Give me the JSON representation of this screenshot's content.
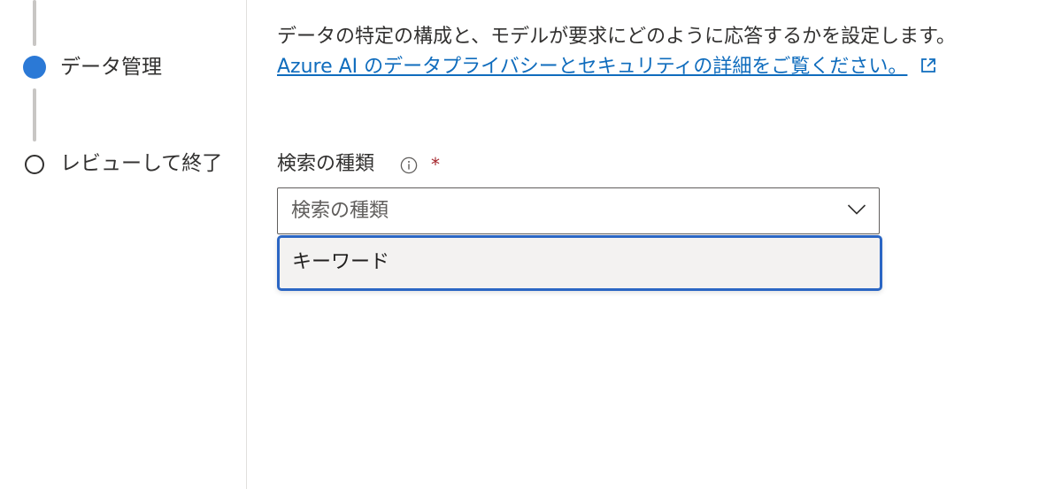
{
  "stepper": {
    "steps": [
      {
        "label": "データ管理",
        "state": "current"
      },
      {
        "label": "レビューして終了",
        "state": "pending"
      }
    ]
  },
  "main": {
    "description": "データの特定の構成と、モデルが要求にどのように応答するかを設定します。",
    "link_text": "Azure AI のデータプライバシーとセキュリティの詳細をご覧ください。",
    "search_type": {
      "label": "検索の種類",
      "required_mark": "*",
      "placeholder": "検索の種類",
      "options": [
        "キーワード"
      ]
    }
  },
  "colors": {
    "accent": "#2b79d6",
    "link": "#0f6cbd",
    "focus_border": "#2b66c4",
    "required": "#a4262c"
  },
  "icons": {
    "info": "info-icon",
    "external_link": "external-link-icon",
    "chevron": "chevron-down-icon"
  }
}
